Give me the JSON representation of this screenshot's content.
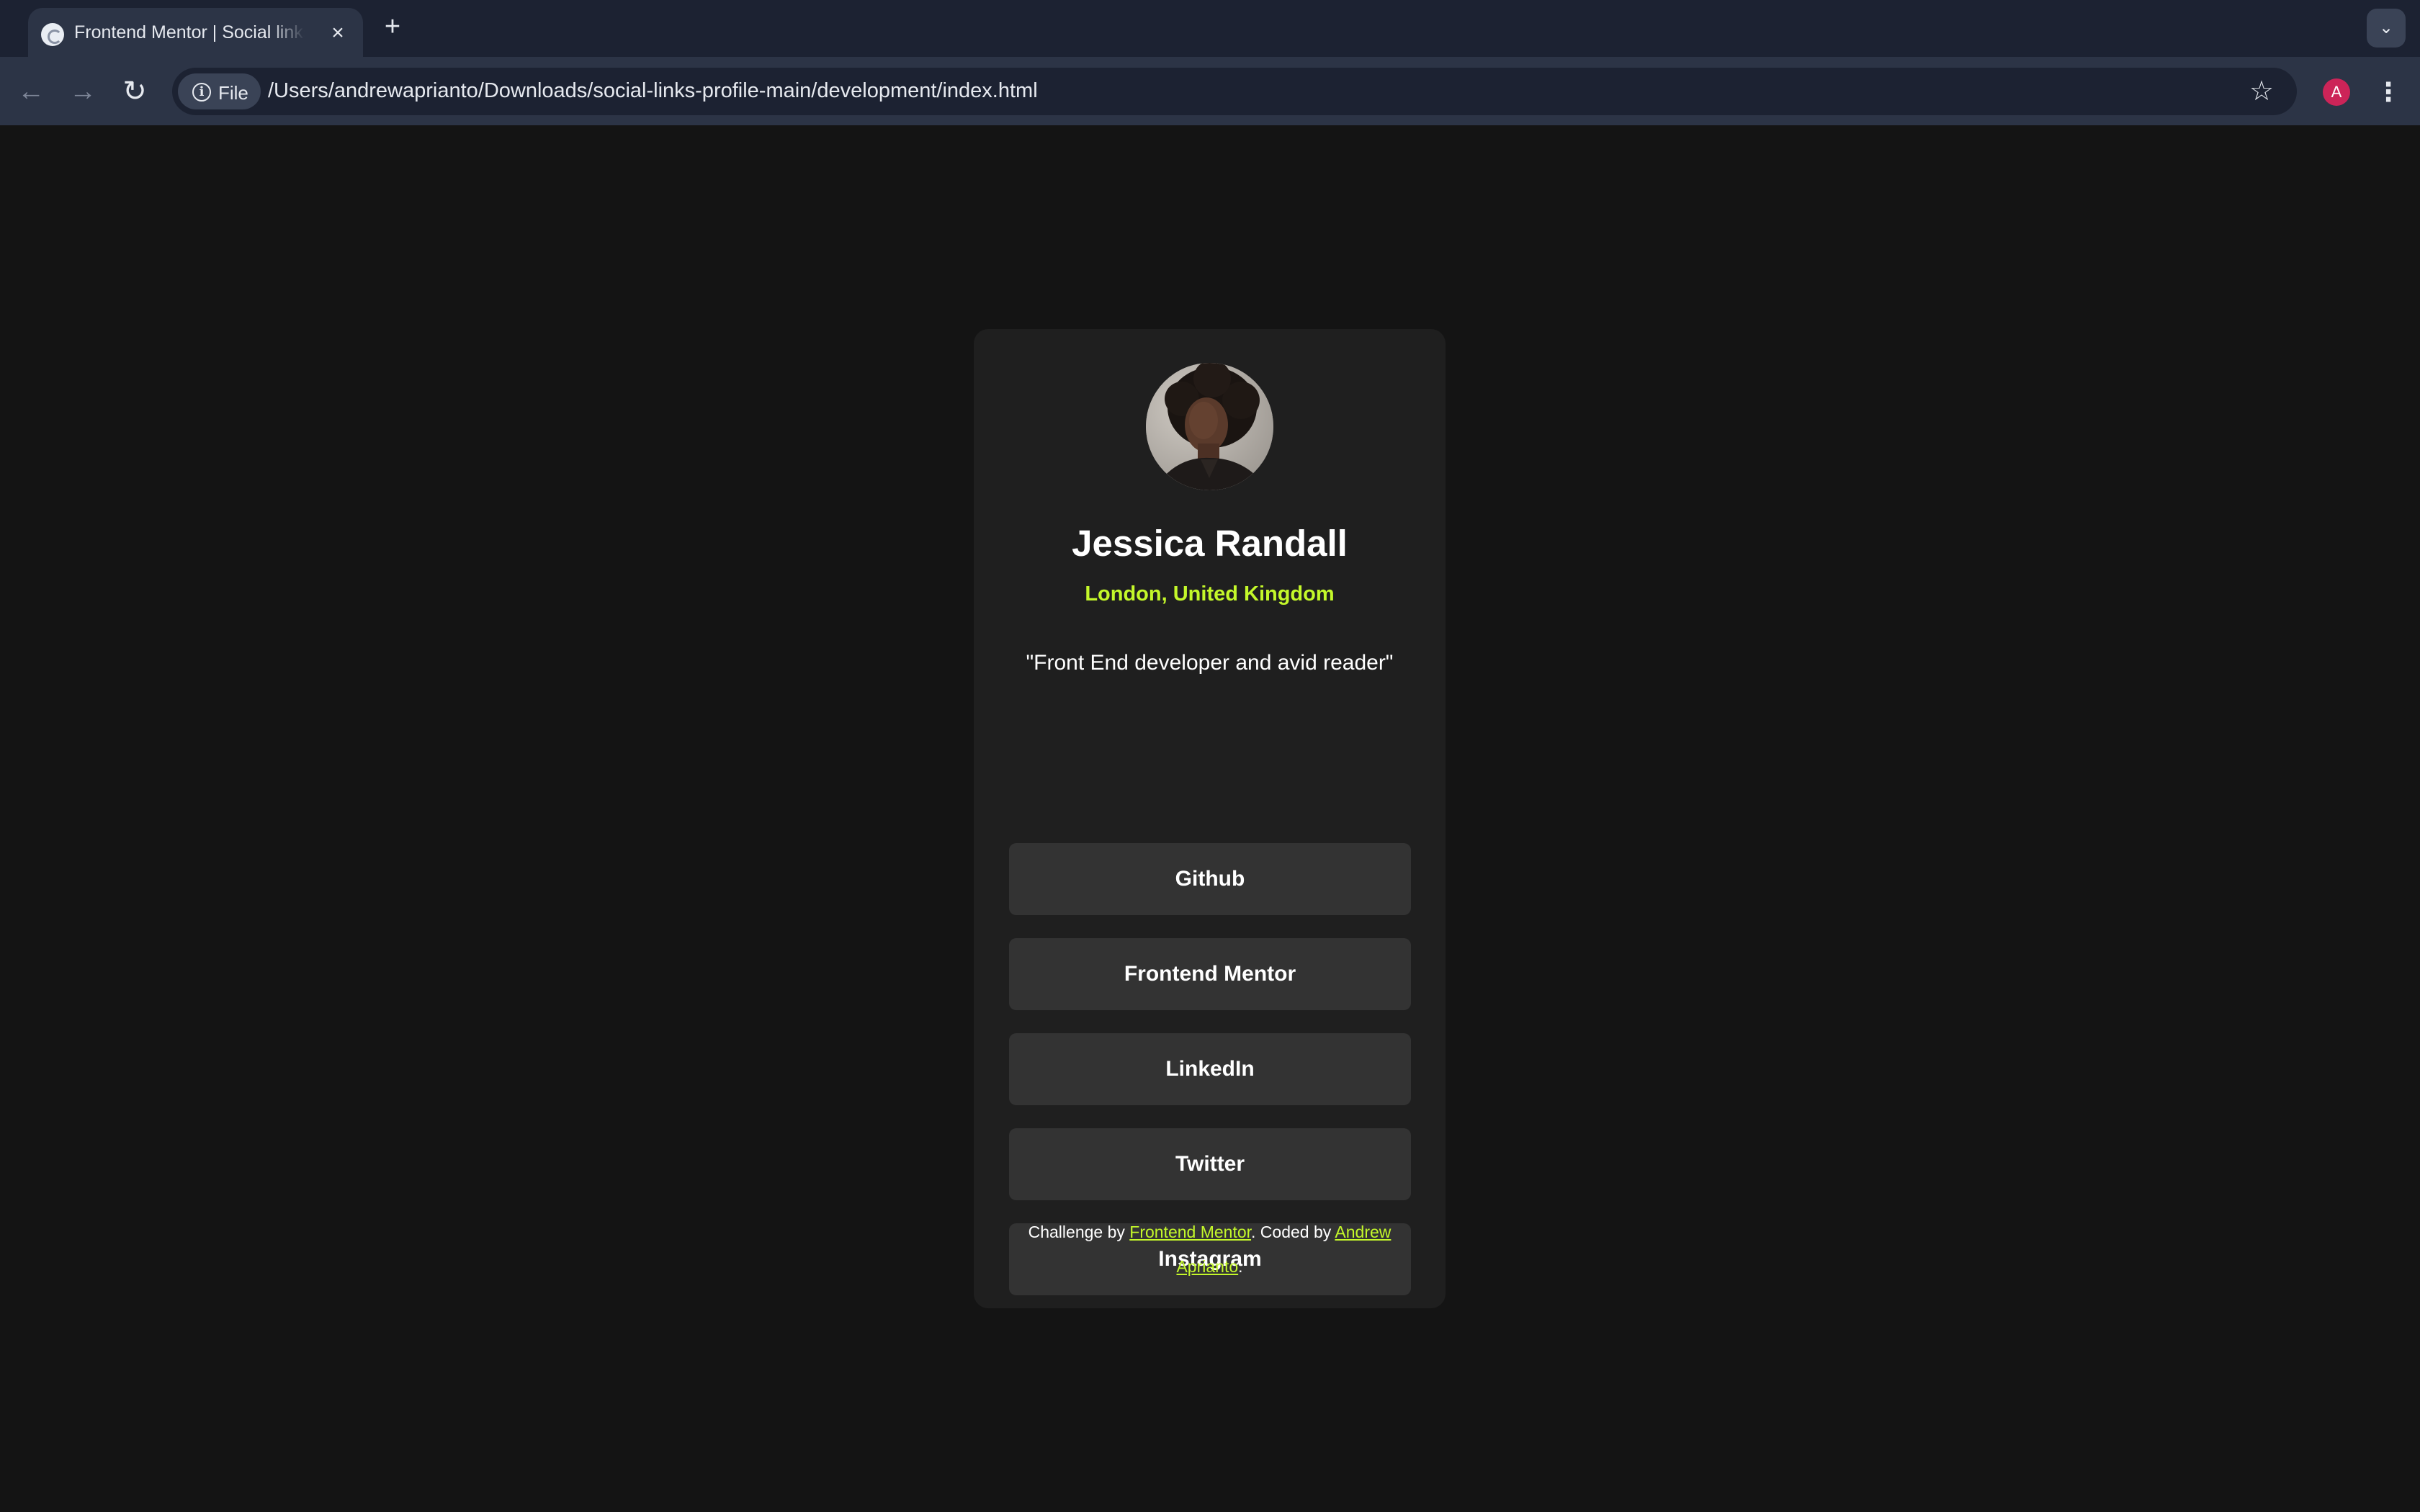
{
  "browser": {
    "tab_title": "Frontend Mentor | Social links profile",
    "tab_close_icon": "×",
    "new_tab_icon": "+",
    "tab_search_icon": "⌄",
    "back_icon": "←",
    "forward_icon": "→",
    "reload_icon": "↻",
    "chip_icon": "i",
    "chip_label": "File",
    "url": "/Users/andrewaprianto/Downloads/social-links-profile-main/development/index.html",
    "star_icon": "☆",
    "profile_initial": "A",
    "menu_icon": "⋮"
  },
  "profile": {
    "name": "Jessica Randall",
    "location": "London, United Kingdom",
    "bio": "\"Front End developer and avid reader\""
  },
  "links": [
    {
      "label": "Github"
    },
    {
      "label": "Frontend Mentor"
    },
    {
      "label": "LinkedIn"
    },
    {
      "label": "Twitter"
    },
    {
      "label": "Instagram"
    }
  ],
  "footer": {
    "prefix": "Challenge by ",
    "challenge_link": "Frontend Mentor",
    "middle": ". Coded by ",
    "author_link": "Andrew Aprianto",
    "suffix": "."
  },
  "colors": {
    "page_bg": "#141414",
    "card_bg": "#1f1f1f",
    "button_bg": "#333333",
    "accent_green": "#c4f82a",
    "browser_bg": "#1c2232",
    "toolbar_bg": "#2c3446",
    "profile_badge": "#cc2458"
  }
}
